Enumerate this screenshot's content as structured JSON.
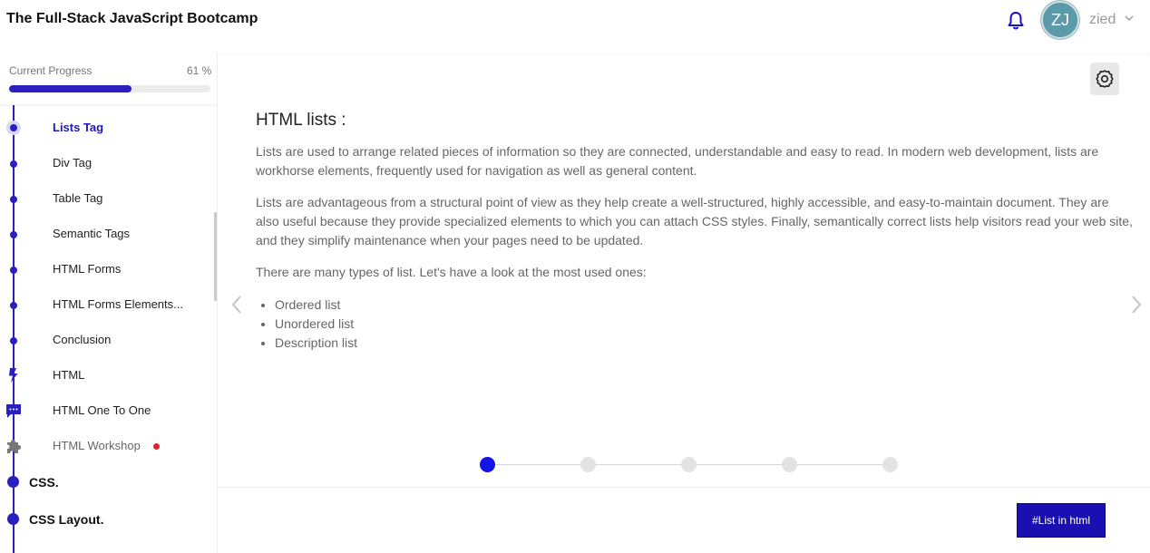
{
  "header": {
    "title": "The Full-Stack JavaScript Bootcamp",
    "bell_icon": "bell-icon",
    "avatar_initials": "ZJ",
    "user_name": "zied",
    "chevron_icon": "chevron-down-icon"
  },
  "sidebar": {
    "progress": {
      "label": "Current Progress",
      "value_text": "61 %",
      "fraction": 0.61
    },
    "items": [
      {
        "label": "Lists Tag",
        "state": "active"
      },
      {
        "label": "Div Tag"
      },
      {
        "label": "Table Tag"
      },
      {
        "label": "Semantic Tags"
      },
      {
        "label": "HTML Forms"
      },
      {
        "label": "HTML Forms Elements..."
      },
      {
        "label": "Conclusion"
      },
      {
        "label": "HTML",
        "icon": "lightning-icon"
      },
      {
        "label": "HTML One To One",
        "icon": "chat-icon"
      },
      {
        "label": "HTML Workshop",
        "icon": "puzzle-icon",
        "badge": "red-dot"
      }
    ],
    "sections": [
      {
        "label": "CSS."
      },
      {
        "label": "CSS Layout."
      }
    ]
  },
  "lesson": {
    "title": "HTML lists :",
    "paragraphs": [
      "Lists are used to arrange related pieces of information so they are connected, understandable and easy to read. In modern web development, lists are workhorse elements, frequently used for navigation as well as general content.",
      "Lists are advantageous from a structural point of view as they help create a well-structured, highly accessible, and easy-to-maintain document. They are also useful because they provide specialized elements to which you can attach CSS styles. Finally, semantically correct lists help visitors read your web site, and they simplify maintenance when your pages need to be updated.",
      "There are many types of list. Let's have a look at the most used ones:"
    ],
    "bullets": [
      "Ordered list",
      "Unordered list",
      "Description list"
    ],
    "settings_icon": "gear-icon",
    "prev_icon": "chevron-left-icon",
    "next_icon": "chevron-right-icon"
  },
  "stepper": {
    "total": 5,
    "current": 1
  },
  "footer": {
    "tag_button": "#List in html"
  },
  "colors": {
    "accent": "#2a1fbf",
    "step_active": "#1414e6",
    "badge": "#e0202a"
  }
}
